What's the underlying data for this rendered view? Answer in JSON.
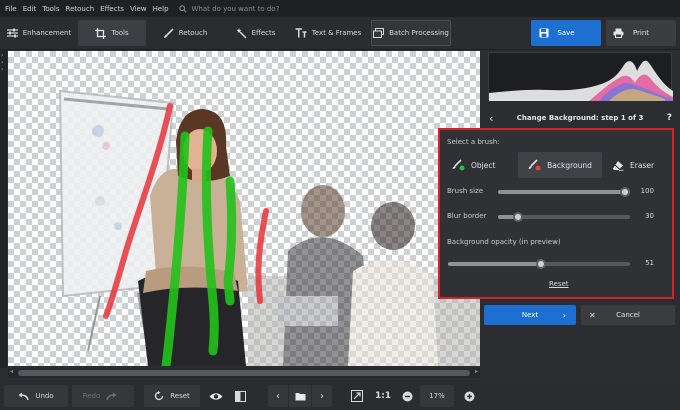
{
  "menu": [
    "File",
    "Edit",
    "Tools",
    "Retouch",
    "Effects",
    "View",
    "Help"
  ],
  "search": {
    "placeholder": "What do you want to do?"
  },
  "toolbar": {
    "tabs": [
      {
        "label": "Enhancement",
        "icon": "sliders-icon"
      },
      {
        "label": "Tools",
        "icon": "crop-icon"
      },
      {
        "label": "Retouch",
        "icon": "brush-icon"
      },
      {
        "label": "Effects",
        "icon": "magic-wand-icon"
      },
      {
        "label": "Text & Frames",
        "icon": "text-icon"
      },
      {
        "label": "Batch Processing",
        "icon": "stack-icon"
      }
    ],
    "active_tab": "Tools",
    "save_label": "Save",
    "print_label": "Print"
  },
  "panel": {
    "step_title": "Change Background: step 1 of 3",
    "help": "?",
    "select_brush_label": "Select a brush:",
    "brushes": [
      {
        "label": "Object",
        "icon": "object-brush-icon",
        "dot_color": "#2fbf3a"
      },
      {
        "label": "Background",
        "icon": "background-brush-icon",
        "dot_color": "#e2452e"
      },
      {
        "label": "Eraser",
        "icon": "eraser-icon"
      }
    ],
    "selected_brush": "Background",
    "brush_size": {
      "label": "Brush size",
      "value": 100,
      "min": 0,
      "max": 100
    },
    "blur_border": {
      "label": "Blur border",
      "value": 30,
      "min": 0,
      "max": 200
    },
    "bg_opacity": {
      "label": "Background opacity (in preview)",
      "value": 51,
      "min": 0,
      "max": 100
    },
    "reset_label": "Reset",
    "next_label": "Next",
    "cancel_label": "Cancel"
  },
  "bottom": {
    "undo_label": "Undo",
    "redo_label": "Redo",
    "reset_label": "Reset",
    "ratio_label": "1:1",
    "zoom": "17%"
  },
  "colors": {
    "accent": "#1d6fd1",
    "highlight_border": "#d6202a",
    "object_stroke": "#22c21a",
    "background_stroke": "#e8343a"
  }
}
